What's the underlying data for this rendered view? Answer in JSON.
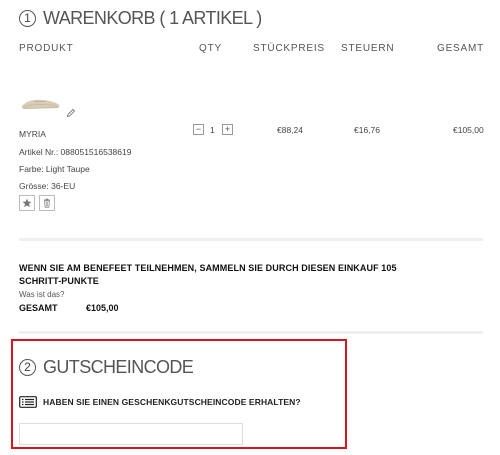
{
  "cart": {
    "step_number": "1",
    "title": "WARENKORB ( 1 ARTIKEL )",
    "columns": {
      "product": "PRODUKT",
      "qty": "QTY",
      "unit_price": "STÜCKPREIS",
      "tax": "STEUERN",
      "total": "GESAMT"
    },
    "item": {
      "name": "MYRIA",
      "sku": "Artikel Nr.: 088051516538619",
      "color": "Farbe: Light Taupe",
      "size": "Grösse: 36-EU",
      "qty_minus": "−",
      "quantity": "1",
      "qty_plus": "+",
      "unit_price": "€88,24",
      "tax": "€16,76",
      "total": "€105,00",
      "icons": [
        "edit-icon",
        "star-icon",
        "trash-icon"
      ]
    }
  },
  "loyalty": {
    "message": "WENN SIE AM BENEFEET TEILNEHMEN, SAMMELN SIE DURCH DIESEN EINKAUF 105 SCHRITT-PUNKTE",
    "link": "Was ist das?",
    "total_label": "GESAMT",
    "total_value": "€105,00"
  },
  "coupon": {
    "step_number": "2",
    "title": "GUTSCHEINCODE",
    "gift_question": "HABEN SIE EINEN GESCHENKGUTSCHEINCODE ERHALTEN?",
    "input_value": "",
    "icons": [
      "gift-card-list-icon"
    ]
  },
  "colors": {
    "highlight_border": "#d8141c",
    "divider": "#efefef",
    "text": "#222222"
  }
}
